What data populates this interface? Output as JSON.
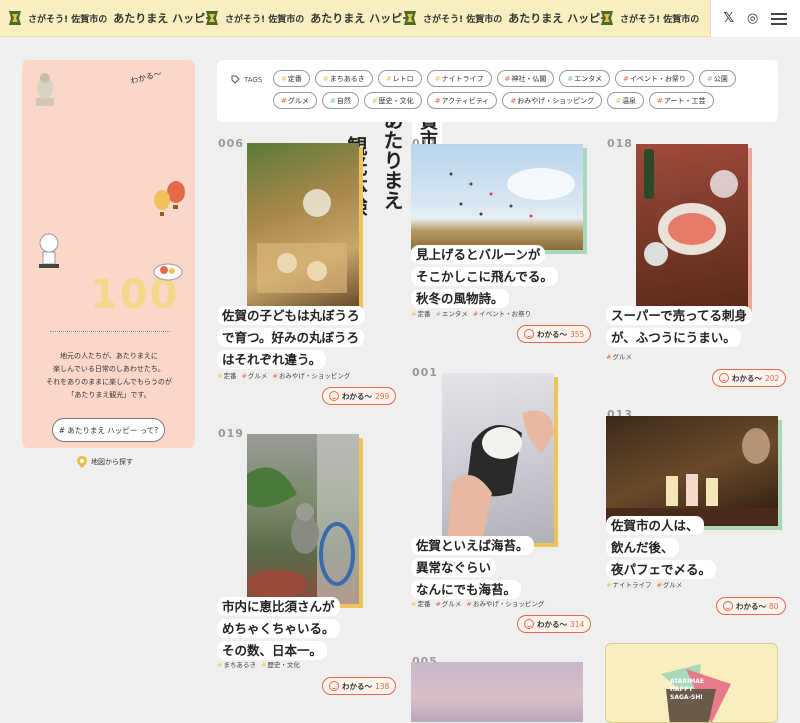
{
  "marquee": {
    "items": [
      {
        "small": "さがそう! 佐賀市の",
        "big": "あたりまえ ハッピー"
      },
      {
        "small": "さがそう! 佐賀市の",
        "big": "あたりまえ ハッピー"
      },
      {
        "small": "さがそう! 佐賀市の",
        "big": "あたりまえ ハッピー"
      },
      {
        "small": "さがそう! 佐賀市の",
        "big": ""
      }
    ]
  },
  "header": {
    "x_label": "𝕏",
    "ig_label": "◎"
  },
  "sidebar": {
    "wakaru": "わかる〜",
    "title_col1": "佐賀市の",
    "title_col2": "あたりまえ",
    "title_col3": "観光体験",
    "number": "100",
    "desc_line1": "地元の人たちが、あたりまえに",
    "desc_line2": "楽しんでいる日常のしあわせたち。",
    "desc_line3": "それをありのままに楽しんでもらうのが",
    "desc_line4": "「あたりまえ観光」です。",
    "button": "# あたりまえ ハッピー って?",
    "map_link": "地図から探す"
  },
  "tags": {
    "label": "TAGS",
    "items": [
      "定番",
      "まちあるき",
      "レトロ",
      "ナイトライフ",
      "神社・仏閣",
      "エンタメ",
      "イベント・お祭り",
      "公園",
      "グルメ",
      "自然",
      "歴史・文化",
      "アクティビティ",
      "おみやげ・ショッピング",
      "温泉",
      "アート・工芸"
    ],
    "colors": [
      "#f0c35a",
      "#f0c35a",
      "#f0c35a",
      "#f0c35a",
      "#e36b4a",
      "#8cc0a0",
      "#e36b4a",
      "#8cc0a0",
      "#e36b4a",
      "#8cc0a0",
      "#f0c35a",
      "#e36b4a",
      "#e36b4a",
      "#f0c35a",
      "#e36b4a"
    ]
  },
  "cards": {
    "c006": {
      "num": "006",
      "lines": [
        "佐賀の子どもは丸ぼうろ",
        "で育つ。好みの丸ぼうろ",
        "はそれぞれ違う。"
      ],
      "tags": [
        "定番",
        "グルメ",
        "おみやげ・ショッピング"
      ],
      "wakaru": "わかる〜",
      "count": "299"
    },
    "c011": {
      "num": "011",
      "lines": [
        "見上げるとバルーンが",
        "そこかしこに飛んでる。",
        "秋冬の風物詩。"
      ],
      "tags": [
        "定番",
        "エンタメ",
        "イベント・お祭り"
      ],
      "wakaru": "わかる〜",
      "count": "355"
    },
    "c018": {
      "num": "018",
      "lines": [
        "スーパーで売ってる刺身",
        "が、ふつうにうまい。"
      ],
      "tags": [
        "グルメ"
      ],
      "wakaru": "わかる〜",
      "count": "202"
    },
    "c019": {
      "num": "019",
      "lines": [
        "市内に恵比須さんが",
        "めちゃくちゃいる。",
        "その数、日本一。"
      ],
      "tags": [
        "まちあるき",
        "歴史・文化"
      ],
      "wakaru": "わかる〜",
      "count": "138"
    },
    "c001": {
      "num": "001",
      "lines": [
        "佐賀といえば海苔。",
        "異常なぐらい",
        "なんにでも海苔。"
      ],
      "tags": [
        "定番",
        "グルメ",
        "おみやげ・ショッピング"
      ],
      "wakaru": "わかる〜",
      "count": "314"
    },
    "c013": {
      "num": "013",
      "lines": [
        "佐賀市の人は、",
        "飲んだ後、",
        "夜パフェで〆る。"
      ],
      "tags": [
        "ナイトライフ",
        "グルメ"
      ],
      "wakaru": "わかる〜",
      "count": "80"
    },
    "c005": {
      "num": "005"
    }
  },
  "yellow_card": {
    "line1": "ATARIMAE",
    "line2": "HAPPY",
    "line3": "SAGA-SHI"
  }
}
